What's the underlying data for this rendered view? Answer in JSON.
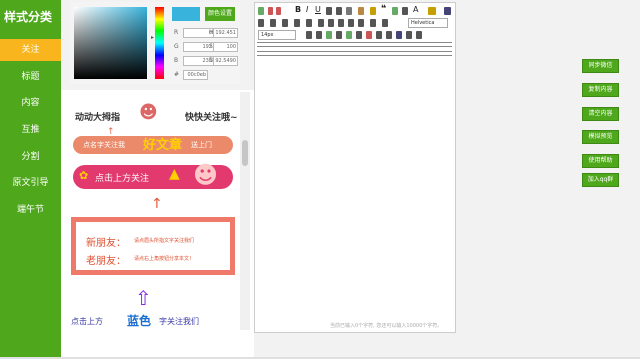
{
  "sidebar": {
    "title": "样式分类",
    "items": [
      {
        "label": "关注",
        "active": true
      },
      {
        "label": "标题",
        "active": false
      },
      {
        "label": "内容",
        "active": false
      },
      {
        "label": "互推",
        "active": false
      },
      {
        "label": "分割",
        "active": false
      },
      {
        "label": "原文引导",
        "active": false
      },
      {
        "label": "端午节",
        "active": false
      }
    ]
  },
  "color_picker": {
    "fields_left": [
      {
        "label": "R",
        "value": "0"
      },
      {
        "label": "G",
        "value": "192"
      },
      {
        "label": "B",
        "value": "235"
      }
    ],
    "fields_right": [
      {
        "label": "H",
        "value": "192.451"
      },
      {
        "label": "S",
        "value": "100"
      },
      {
        "label": "B",
        "value": "92.5490"
      }
    ],
    "hex_value": "00c0eb",
    "set_color_label": "颜色设置",
    "current_color": "#37b3dc"
  },
  "templates": {
    "t1": {
      "text": "动动大拇指",
      "text2": "快快关注哦~"
    },
    "t2": {
      "text": "点名字关注我",
      "big": "好文章",
      "tail": "送上门"
    },
    "t3": {
      "text": "点击上方关注"
    },
    "t4": {
      "line1_label": "新朋友：",
      "line1_text": "请点眉头所指文字关注我们",
      "line2_label": "老朋友：",
      "line2_text": "请点右上角按钮分享本文！"
    },
    "t5": {
      "left": "点击上方",
      "mid": "蓝色",
      "right": "字关注我们"
    }
  },
  "editor": {
    "font_name": "Helvetica",
    "font_size": "14px",
    "counter_text": "当前已输入0个字符, 您还可以输入10000个字符。"
  },
  "actions": [
    {
      "label": "同步微信"
    },
    {
      "label": "复制内容"
    },
    {
      "label": "清空内容"
    },
    {
      "label": "模拟预览"
    },
    {
      "label": "使用帮助"
    },
    {
      "label": "加入qq群"
    }
  ]
}
